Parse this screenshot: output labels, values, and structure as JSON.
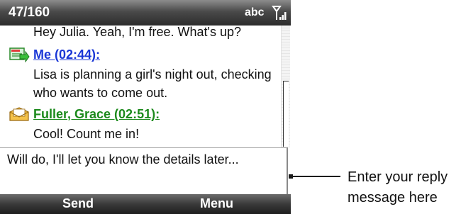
{
  "status_bar": {
    "counter": "47/160",
    "input_mode": "abc",
    "signal_icon": "signal-antenna-icon"
  },
  "thread": {
    "colors": {
      "me": "#1a37d6",
      "other": "#1c8a1c"
    },
    "partial_message": "Hey Julia. Yeah, I'm free. What's up?",
    "messages": [
      {
        "sender": "Me (02:44):",
        "icon": "sent-message-icon",
        "lines": [
          "Lisa is planning a girl's night out, checking",
          "who wants to come out."
        ]
      },
      {
        "sender": "Fuller, Grace (02:51):",
        "icon": "received-message-icon",
        "lines": [
          "Cool! Count me in!"
        ]
      }
    ]
  },
  "reply": {
    "value": "Will do, I'll let you know the details later..."
  },
  "softkeys": {
    "left": "Send",
    "right": "Menu"
  },
  "callout": {
    "line1": "Enter your reply",
    "line2": "message here"
  }
}
